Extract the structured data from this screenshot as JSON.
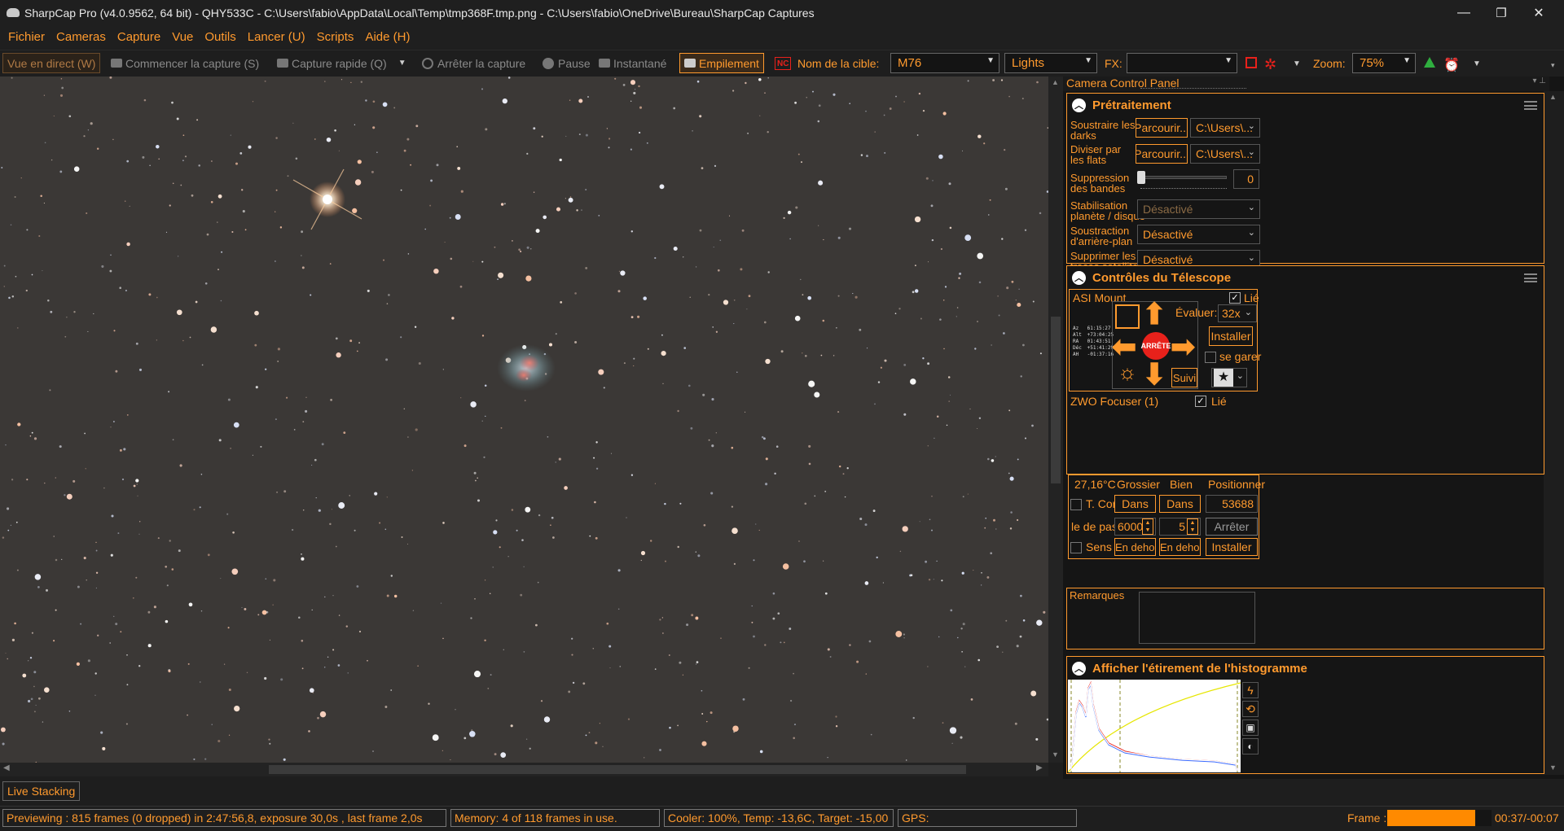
{
  "window": {
    "title": "SharpCap Pro (v4.0.9562, 64 bit) - QHY533C - C:\\Users\\fabio\\AppData\\Local\\Temp\\tmp368F.tmp.png - C:\\Users\\fabio\\OneDrive\\Bureau\\SharpCap Captures",
    "minimize": "—",
    "restore": "❐",
    "close": "✕"
  },
  "menu": [
    "Fichier",
    "Cameras",
    "Capture",
    "Vue",
    "Outils",
    "Lancer (U)",
    "Scripts",
    "Aide (H)"
  ],
  "toolbar": {
    "live_view": "Vue en direct (W)",
    "start_capture": "Commencer la capture (S)",
    "quick_capture": "Capture rapide (Q)",
    "stop_capture": "Arrêter la capture",
    "pause": "Pause",
    "snapshot": "Instantané",
    "stacking": "Empilement",
    "nc_badge": "NC",
    "target_label": "Nom de la cible:",
    "target_value": "M76",
    "frame_type": "Lights",
    "fx_label": "FX:",
    "fx_value": "",
    "zoom_label": "Zoom:",
    "zoom_value": "75%"
  },
  "panel": {
    "title": "Camera Control Panel",
    "preprocessing": {
      "title": "Prétraitement",
      "subtract_darks_label": "Soustraire les darks",
      "divide_flats_label": "Diviser par les flats",
      "browse": "Parcourir...",
      "darks_path": "C:\\Users\\...",
      "flats_path": "C:\\Users\\...",
      "banding_label": "Suppression des bandes",
      "banding_value": "0",
      "banding_level": 0,
      "stabilisation_label": "Stabilisation planète / disque",
      "stabilisation_value": "Désactivé",
      "background_label": "Soustraction d'arrière-plan",
      "background_value": "Désactivé",
      "satellite_label": "Supprimer les traces satellites",
      "satellite_value": "Désactivé"
    },
    "telescope": {
      "title": "Contrôles du Télescope",
      "mount_name": "ASI Mount",
      "linked_label": "Lié",
      "rate_label": "Évaluer:",
      "rate_value": "32x",
      "install": "Installer",
      "stop": "ARRÊTE",
      "park": "se garer",
      "tracking": "Suivi",
      "readout": [
        {
          "k": "Az",
          "v": "61:15:27"
        },
        {
          "k": "Alt",
          "v": "+73:04:25"
        },
        {
          "k": "RA",
          "v": "01:43:51"
        },
        {
          "k": "Déc",
          "v": "+51:41:29"
        },
        {
          "k": "AH",
          "v": "-01:37:16"
        }
      ]
    },
    "focuser": {
      "title": "ZWO Focuser (1)",
      "linked_label": "Lié",
      "temperature": "27,16°C",
      "coarse": "Grossier",
      "fine": "Bien",
      "position_label": "Positionner",
      "t_comp": "T. Cor",
      "in": "Dans",
      "position_value": "53688",
      "step_label": "le de pas",
      "coarse_step": "6000",
      "fine_step": "5",
      "stop": "Arrêter",
      "reverse": "Sens i",
      "out": "En dehors",
      "install": "Installer"
    },
    "notes_label": "Remarques",
    "histogram": {
      "title": "Afficher l'étirement de l'histogramme"
    }
  },
  "live_stacking_label": "Live Stacking",
  "status": {
    "preview": "Previewing : 815 frames (0 dropped) in 2:47:56,8, exposure 30,0s , last frame 2,0s",
    "memory": "Memory: 4 of 118 frames in use.",
    "cooler": "Cooler: 100%, Temp: -13,6C, Target: -15,00",
    "gps": "GPS:",
    "frame_label": "Frame :",
    "frame_time": "00:37/-00:07",
    "frame_progress": 0.84
  },
  "colors": {
    "accent": "#ff9a2e",
    "background": "#1e1e1e",
    "sky": "#3b3836",
    "stop_red": "#e8211b"
  }
}
